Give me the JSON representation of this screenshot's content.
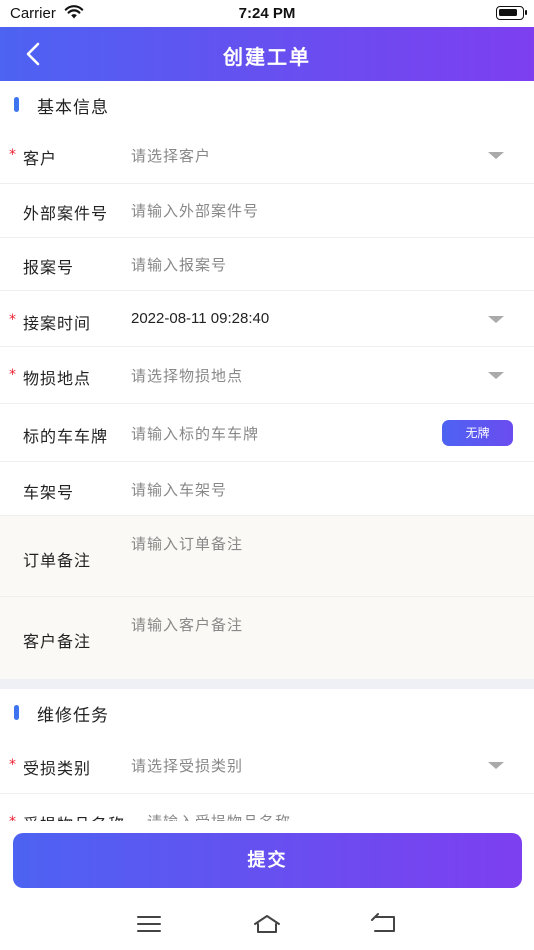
{
  "status_bar": {
    "carrier": "Carrier",
    "time": "7:24 PM"
  },
  "nav": {
    "title": "创建工单"
  },
  "sections": {
    "basic": {
      "title": "基本信息"
    },
    "repair": {
      "title": "维修任务"
    }
  },
  "fields": {
    "customer": {
      "label": "客户",
      "placeholder": "请选择客户",
      "required": "*"
    },
    "external_case": {
      "label": "外部案件号",
      "placeholder": "请输入外部案件号"
    },
    "report_no": {
      "label": "报案号",
      "placeholder": "请输入报案号"
    },
    "receive_time": {
      "label": "接案时间",
      "value": "2022-08-11 09:28:40",
      "required": "*"
    },
    "loss_location": {
      "label": "物损地点",
      "placeholder": "请选择物损地点",
      "required": "*"
    },
    "plate": {
      "label": "标的车车牌",
      "placeholder": "请输入标的车车牌",
      "badge": "无牌"
    },
    "vin": {
      "label": "车架号",
      "placeholder": "请输入车架号"
    },
    "order_note": {
      "label": "订单备注",
      "placeholder": "请输入订单备注"
    },
    "customer_note": {
      "label": "客户备注",
      "placeholder": "请输入客户备注"
    },
    "damage_type": {
      "label": "受损类别",
      "placeholder": "请选择受损类别",
      "required": "*"
    },
    "damage_item": {
      "label": "受损物品名称",
      "placeholder": "请输入受损物品名称",
      "required": "*"
    }
  },
  "submit_label": "提交",
  "icons": {
    "back": "chevron-left-icon",
    "wifi": "wifi-icon",
    "battery": "battery-icon",
    "menu": "menu-icon",
    "home": "home-icon",
    "return": "return-icon"
  },
  "colors": {
    "brand_start": "#4d63f2",
    "brand_end": "#7d3ff0",
    "required": "#ee2233",
    "section_accent": "#3f74f0"
  }
}
